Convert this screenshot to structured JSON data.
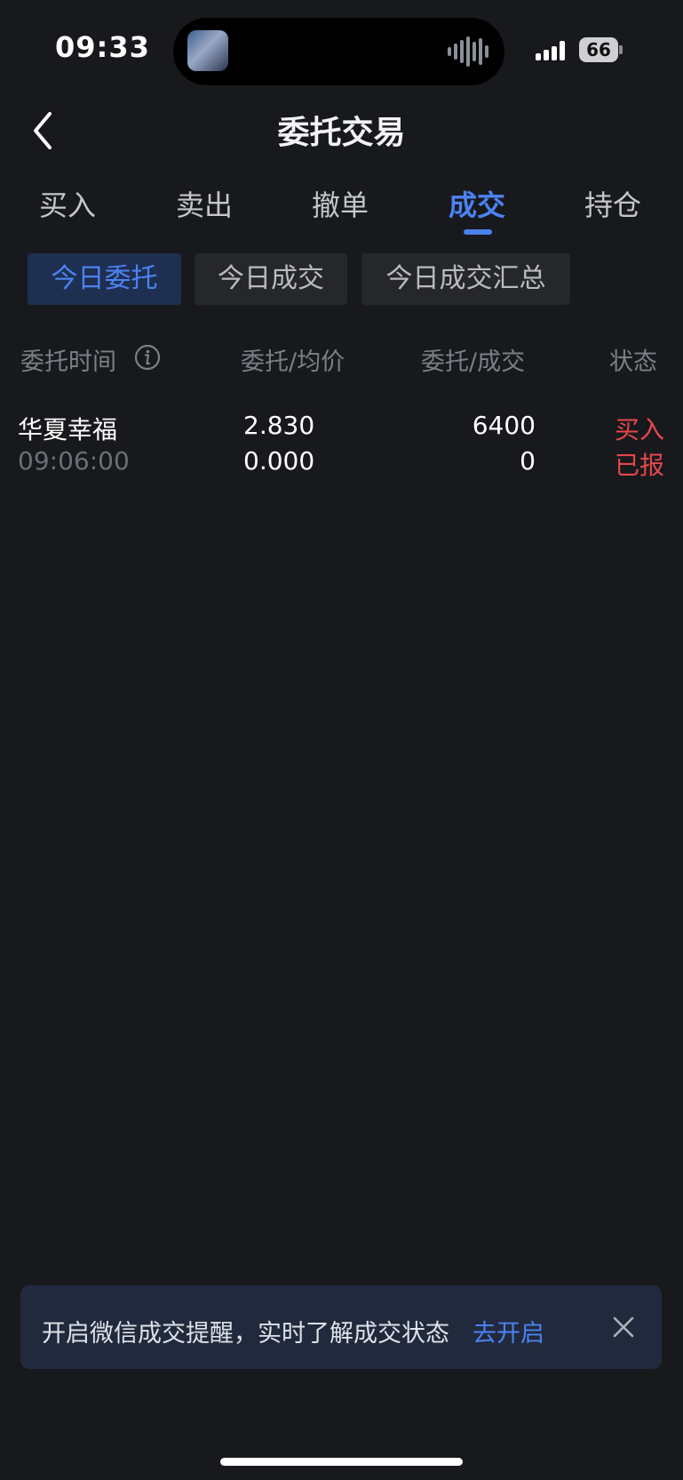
{
  "status_bar": {
    "time": "09:33",
    "battery": "66"
  },
  "nav": {
    "title": "委托交易"
  },
  "tabs": [
    {
      "label": "买入"
    },
    {
      "label": "卖出"
    },
    {
      "label": "撤单"
    },
    {
      "label": "成交",
      "active": true
    },
    {
      "label": "持仓"
    }
  ],
  "chips": [
    {
      "label": "今日委托",
      "active": true
    },
    {
      "label": "今日成交"
    },
    {
      "label": "今日成交汇总"
    }
  ],
  "table": {
    "headers": [
      "委托时间",
      "委托/均价",
      "委托/成交",
      "状态"
    ],
    "rows": [
      {
        "name": "华夏幸福",
        "time": "09:06:00",
        "price": "2.830",
        "avg_price": "0.000",
        "order_qty": "6400",
        "filled_qty": "0",
        "side": "买入",
        "status": "已报"
      }
    ]
  },
  "banner": {
    "text": "开启微信成交提醒，实时了解成交状态",
    "link": "去开启"
  },
  "colors": {
    "background": "#18191d",
    "accent": "#4b82f1",
    "buy_red": "#e5474a"
  }
}
